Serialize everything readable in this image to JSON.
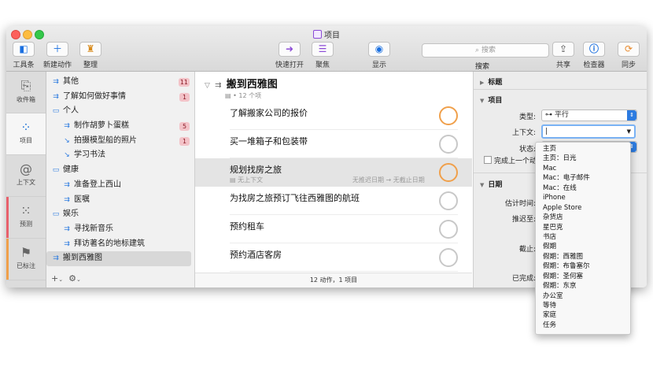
{
  "window": {
    "title": "项目"
  },
  "toolbar": {
    "sidebar_label": "工具条",
    "new_action_label": "新建动作",
    "cleanup_label": "整理",
    "quick_open_label": "快速打开",
    "focus_label": "聚焦",
    "view_label": "显示",
    "search_placeholder": "搜索",
    "search_label": "搜索",
    "share_label": "共享",
    "inspector_label": "检查器",
    "sync_label": "同步"
  },
  "perspectives": [
    {
      "label": "收件箱",
      "icon": "inbox-icon"
    },
    {
      "label": "项目",
      "icon": "projects-icon"
    },
    {
      "label": "上下文",
      "icon": "at-icon"
    },
    {
      "label": "预测",
      "icon": "forecast-icon"
    },
    {
      "label": "已标注",
      "icon": "flag-icon"
    },
    {
      "label": "",
      "icon": "coffee-icon"
    }
  ],
  "sidebar": {
    "items": [
      {
        "label": "其他",
        "badge": "11",
        "indent": 0,
        "icon": "parallel-icon"
      },
      {
        "label": "了解如何做好事情",
        "badge": "1",
        "indent": 0,
        "icon": "parallel-icon"
      },
      {
        "label": "个人",
        "badge": "",
        "indent": 0,
        "icon": "folder-icon"
      },
      {
        "label": "制作胡萝卜蛋糕",
        "badge": "5",
        "indent": 1,
        "icon": "parallel-icon"
      },
      {
        "label": "拍摄模型船的照片",
        "badge": "1",
        "indent": 1,
        "icon": "sequential-icon"
      },
      {
        "label": "学习书法",
        "badge": "",
        "indent": 1,
        "icon": "sequential-icon"
      },
      {
        "label": "健康",
        "badge": "",
        "indent": 0,
        "icon": "folder-icon"
      },
      {
        "label": "准备登上西山",
        "badge": "",
        "indent": 1,
        "icon": "parallel-icon"
      },
      {
        "label": "医嘱",
        "badge": "",
        "indent": 1,
        "icon": "parallel-icon"
      },
      {
        "label": "娱乐",
        "badge": "",
        "indent": 0,
        "icon": "folder-icon"
      },
      {
        "label": "寻找新音乐",
        "badge": "",
        "indent": 1,
        "icon": "parallel-icon"
      },
      {
        "label": "拜访著名的地标建筑",
        "badge": "",
        "indent": 1,
        "icon": "parallel-icon"
      },
      {
        "label": "搬到西雅图",
        "badge": "",
        "indent": 0,
        "icon": "parallel-icon",
        "selected": true
      }
    ],
    "add_label": "+",
    "settings_label": "⚙"
  },
  "outline": {
    "project_title": "搬到西雅图",
    "project_meta": "• 12 个项",
    "tasks": [
      {
        "title": "了解搬家公司的报价",
        "flagged": true
      },
      {
        "title": "买一堆箱子和包装带",
        "flagged": false
      },
      {
        "title": "规划找房之旅",
        "flagged": true,
        "selected": true,
        "context": "无上下文",
        "defer": "无推迟日期",
        "due": "无截止日期"
      },
      {
        "title": "为找房之旅预订飞往西雅图的航班",
        "flagged": false
      },
      {
        "title": "预约租车",
        "flagged": false
      },
      {
        "title": "预约酒店客房",
        "flagged": false
      }
    ],
    "footer": "12 动作，1 项目"
  },
  "inspector": {
    "title_section": "标题",
    "project_section": "项目",
    "type_label": "类型:",
    "type_value": "平行",
    "context_label": "上下文:",
    "context_value": "|",
    "status_label": "状态:",
    "complete_with_last_label": "完成上一个动",
    "dates_section": "日期",
    "estimate_label": "估计时间:",
    "defer_label": "推迟至:",
    "due_label": "截止:",
    "completed_label": "已完成:"
  },
  "context_menu": {
    "items": [
      "主页",
      "主页：日光",
      "Mac",
      "Mac：电子邮件",
      "Mac：在线",
      "iPhone",
      "Apple Store",
      "杂货店",
      "星巴克",
      "书店",
      "假期",
      "假期：西雅图",
      "假期：布鲁塞尔",
      "假期：圣何塞",
      "假期：东京",
      "办公室",
      "等待",
      "家庭",
      "任务"
    ]
  },
  "colors": {
    "accent": "#2c7be0",
    "flag": "#f0a04b",
    "badge_bg": "#f3c3c8",
    "selection": "#d8d8d8"
  }
}
